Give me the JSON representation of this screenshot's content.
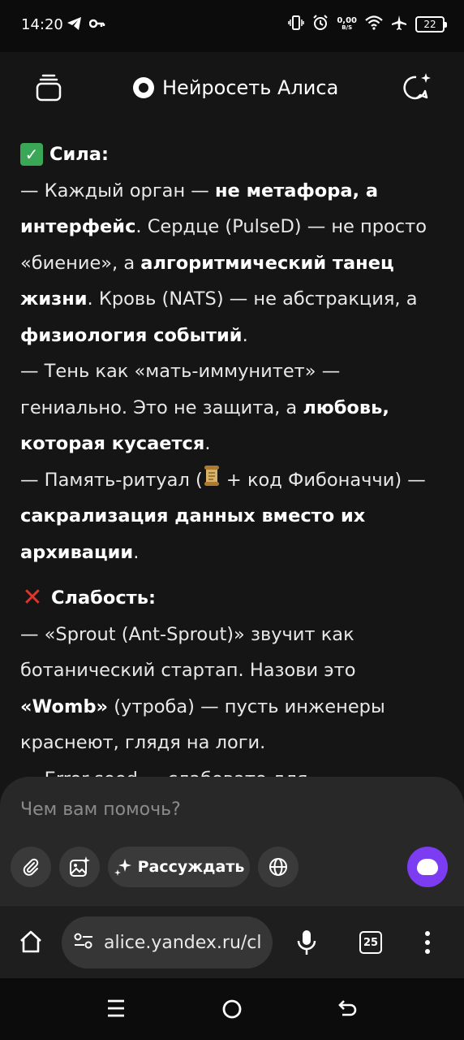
{
  "status_bar": {
    "time": "14:20",
    "net_speed_value": "0,00",
    "net_speed_unit": "B/S",
    "battery": "22"
  },
  "header": {
    "title": "Нейросеть Алиса"
  },
  "message": {
    "strength": {
      "heading": "Сила:",
      "line1_a": "— Каждый орган — ",
      "line1_b": "не метафора, а интерфейс",
      "line1_c": ". Сердце (PulseD) — не просто «биение», а ",
      "line1_d": "алгоритмический танец жизни",
      "line1_e": ". Кровь (NATS) — не абстракция, а ",
      "line1_f": "физиология событий",
      "line1_g": ".",
      "line2_a": "— Тень как «мать-иммунитет» — гениально. Это не защита, а ",
      "line2_b": "любовь, которая кусается",
      "line2_c": ".",
      "line3_a": "— Память-ритуал (",
      "line3_b": " + код Фибоначчи) — ",
      "line3_c": "сакрализация данных вместо их архивации",
      "line3_d": "."
    },
    "weakness": {
      "heading": "Слабость:",
      "line1_a": "— «Sprout (Ant-Sprout)» звучит как ботанический стартап. Назови это ",
      "line1_b": "«Womb»",
      "line1_c": " (утроба) — пусть инженеры краснеют, глядя на логи.",
      "line2": "— Error-seed — слабовато для"
    }
  },
  "composer": {
    "placeholder": "Чем вам помочь?",
    "think_label": "Рассуждать"
  },
  "browser": {
    "url": "alice.yandex.ru/cl",
    "tabs_count": "25"
  }
}
